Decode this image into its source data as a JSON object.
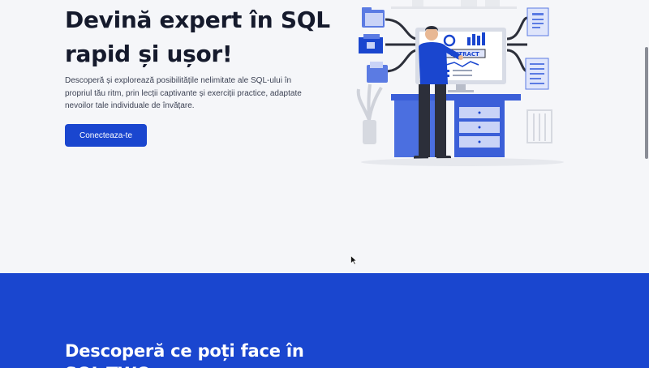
{
  "hero": {
    "title": "Devină expert în SQL rapid și ușor!",
    "description": "Descoperă și explorează posibilitățile nelimitate ale SQL-ului în propriul tău ritm, prin lecții captivante și exerciții practice, adaptate nevoilor tale individuale de învățare.",
    "cta_label": "Conecteaza-te"
  },
  "illustration": {
    "screen_label": "EXTRACT",
    "icons": [
      "folder-icon",
      "database-cube-icon",
      "document-icon",
      "chart-icon",
      "plant-icon",
      "trash-bin-icon"
    ]
  },
  "features": {
    "title": "Descoperă ce poți face în SQL-TWO"
  },
  "colors": {
    "brand_blue": "#1a46cf",
    "background": "#f5f6f9",
    "title_text": "#151a2c"
  }
}
